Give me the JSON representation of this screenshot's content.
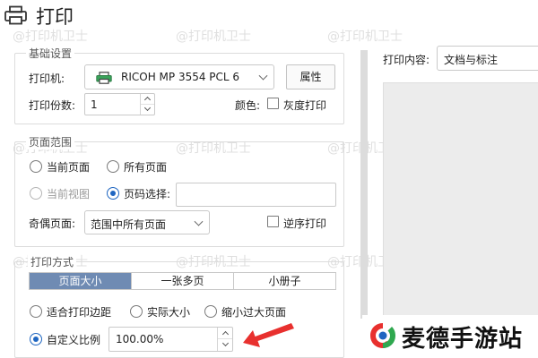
{
  "window": {
    "title": "打印"
  },
  "basic": {
    "legend": "基础设置",
    "printer_label": "打印机:",
    "printer_value": "RICOH MP 3554 PCL 6",
    "properties_btn": "属性",
    "copies_label": "打印份数:",
    "copies_value": "1",
    "color_label": "颜色:",
    "grayscale_label": "灰度打印"
  },
  "range": {
    "legend": "页面范围",
    "current_page": "当前页面",
    "all_pages": "所有页面",
    "current_view": "当前视图",
    "page_select": "页码选择:",
    "page_select_value": "",
    "odd_even_label": "奇偶页面:",
    "odd_even_value": "范围中所有页面",
    "reverse_label": "逆序打印"
  },
  "method": {
    "legend": "打印方式",
    "tabs": [
      "页面大小",
      "一张多页",
      "小册子"
    ],
    "active_tab": 0,
    "fit_margin": "适合打印边距",
    "actual_size": "实际大小",
    "shrink_large": "缩小过大页面",
    "custom_scale": "自定义比例",
    "custom_scale_value": "100.00%"
  },
  "content": {
    "label": "打印内容:",
    "value": "文档与标注"
  },
  "watermark": {
    "text": "@打印机卫士"
  },
  "brand": {
    "name": "麦德手游站"
  },
  "colors": {
    "accent": "#1f66c1",
    "tab_active": "#6f8bb3",
    "arrow": "#e8302e",
    "preview_bg": "#ececec"
  }
}
